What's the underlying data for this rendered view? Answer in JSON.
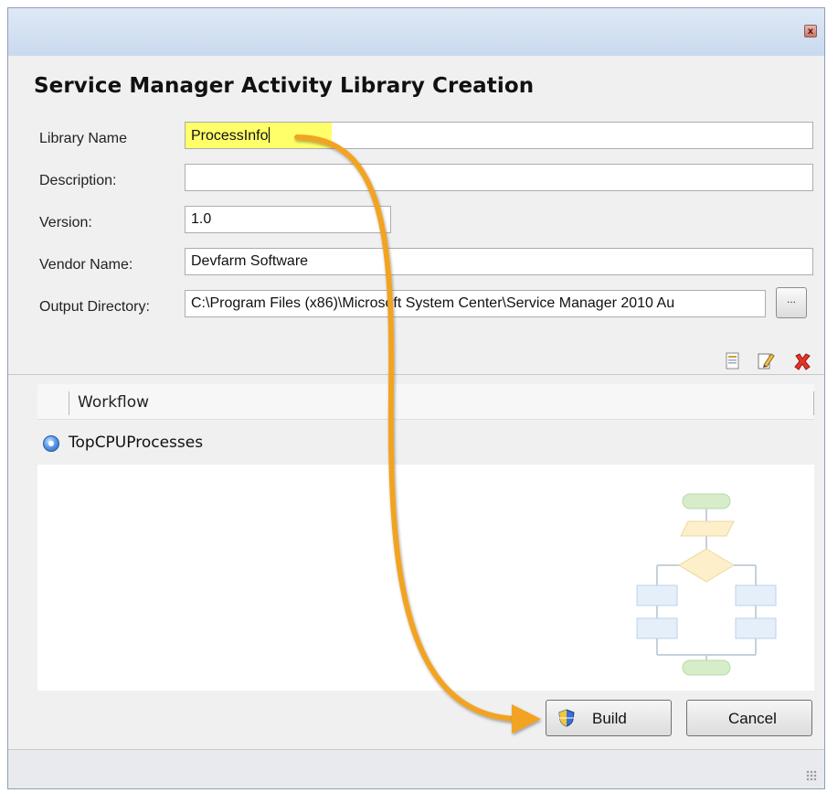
{
  "dialog": {
    "heading": "Service Manager Activity Library Creation",
    "close_symbol": "x"
  },
  "form": {
    "library_name_label": "Library Name",
    "library_name_value": "ProcessInfo",
    "description_label": "Description:",
    "description_value": "",
    "version_label": "Version:",
    "version_value": "1.0",
    "vendor_label": "Vendor Name:",
    "vendor_value": "Devfarm Software",
    "output_label": "Output Directory:",
    "output_value": "C:\\Program Files (x86)\\Microsoft System Center\\Service Manager 2010 Au",
    "browse_label": "..."
  },
  "toolbar": {
    "icons": [
      "new-workflow-icon",
      "edit-workflow-icon",
      "delete-icon"
    ]
  },
  "grid": {
    "column_header": "Workflow",
    "rows": [
      {
        "name": "TopCPUProcesses",
        "icon": "workflow-item-icon"
      }
    ]
  },
  "buttons": {
    "build_label": "Build",
    "cancel_label": "Cancel"
  },
  "colors": {
    "highlight": "#ffff6a",
    "annotation_arrow": "#f2a321"
  }
}
